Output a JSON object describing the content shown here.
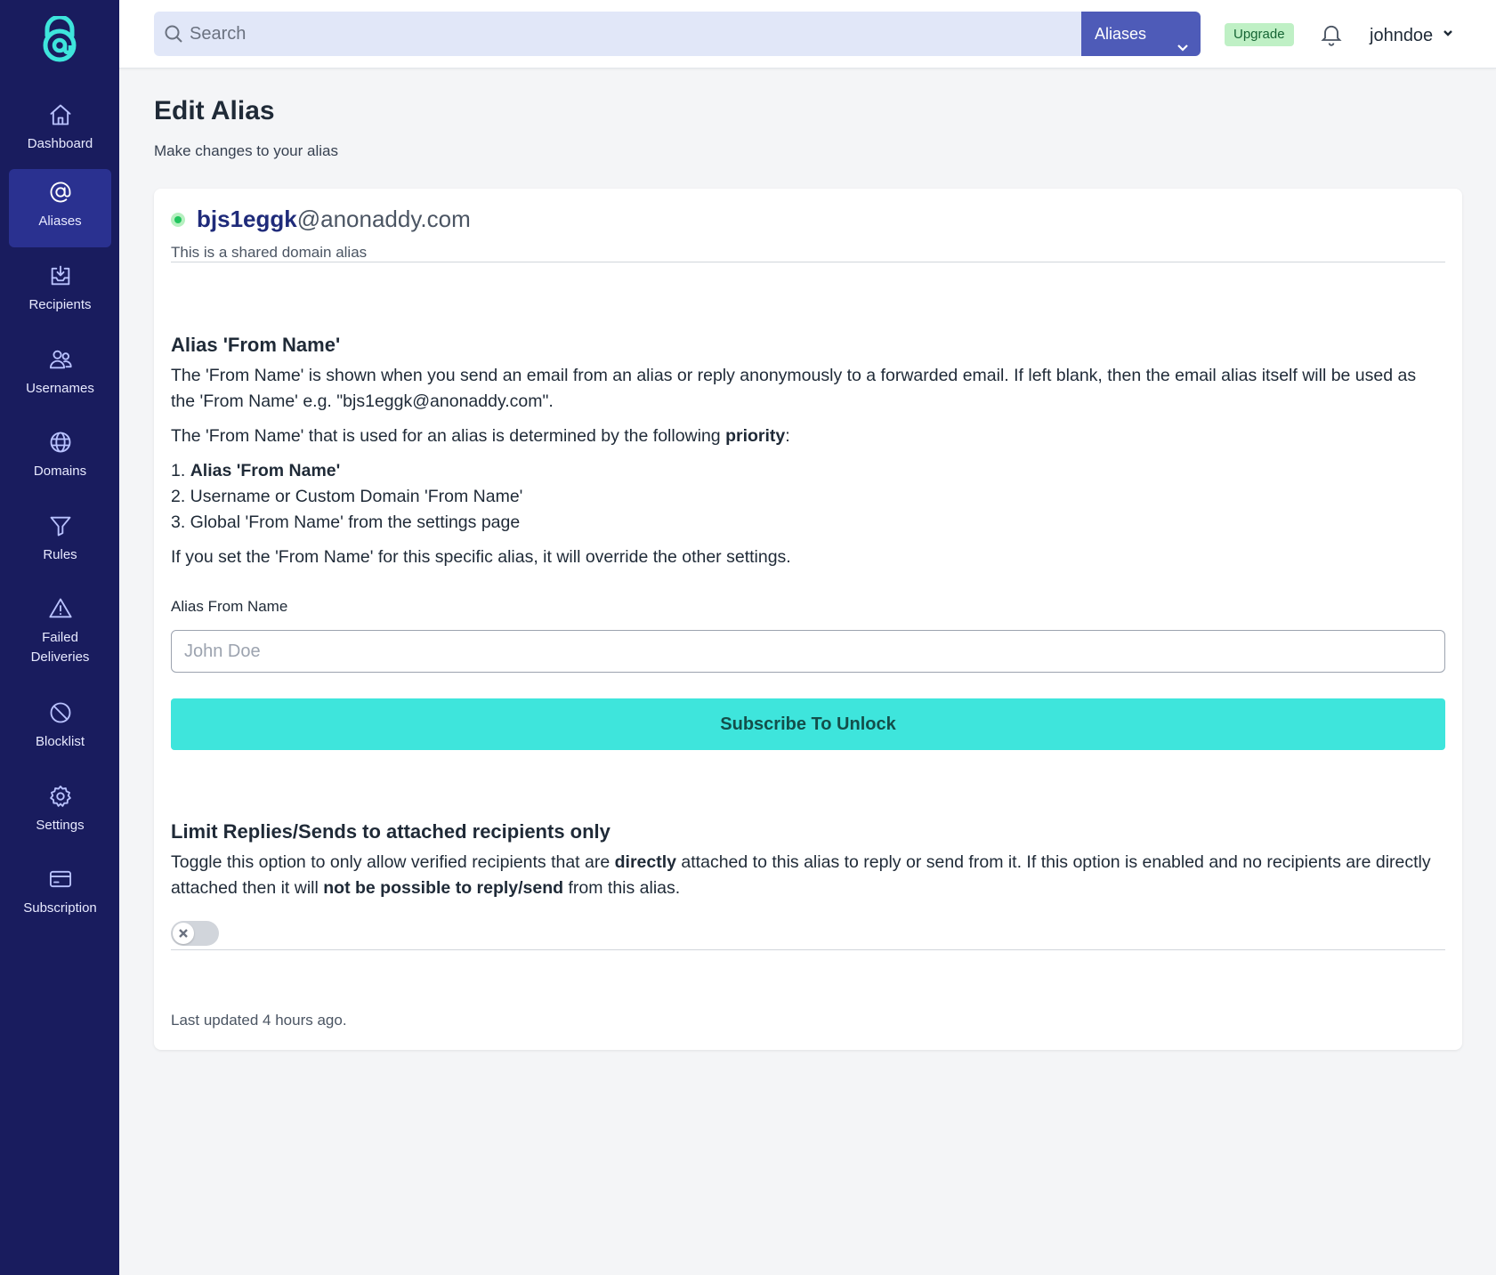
{
  "sidebar": {
    "items": [
      {
        "label": "Dashboard",
        "icon": "home-icon"
      },
      {
        "label": "Aliases",
        "icon": "at-icon"
      },
      {
        "label": "Recipients",
        "icon": "inbox-icon"
      },
      {
        "label": "Usernames",
        "icon": "users-icon"
      },
      {
        "label": "Domains",
        "icon": "globe-icon"
      },
      {
        "label": "Rules",
        "icon": "funnel-icon"
      },
      {
        "label": "Failed\nDeliveries",
        "icon": "warning-icon"
      },
      {
        "label": "Blocklist",
        "icon": "ban-icon"
      },
      {
        "label": "Settings",
        "icon": "gear-icon"
      },
      {
        "label": "Subscription",
        "icon": "credit-card-icon"
      }
    ],
    "active": "Aliases"
  },
  "topbar": {
    "search_placeholder": "Search",
    "search_scope": "Aliases",
    "upgrade_label": "Upgrade",
    "username": "johndoe"
  },
  "page": {
    "title": "Edit Alias",
    "subtitle": "Make changes to your alias"
  },
  "alias": {
    "local_part": "bjs1eggk",
    "domain_part": "@anonaddy.com",
    "description": "This is a shared domain alias",
    "active": true
  },
  "from_name_section": {
    "title": "Alias 'From Name'",
    "para1": "The 'From Name' is shown when you send an email from an alias or reply anonymously to a forwarded email. If left blank, then the email alias itself will be used as the 'From Name' e.g. \"bjs1eggk@anonaddy.com\".",
    "para2_prefix": "The 'From Name' that is used for an alias is determined by the following ",
    "para2_bold": "priority",
    "para2_suffix": ":",
    "priority_1_num": "1. ",
    "priority_1": "Alias 'From Name'",
    "priority_2": "2. Username or Custom Domain 'From Name'",
    "priority_3": "3. Global 'From Name' from the settings page",
    "para3": "If you set the 'From Name' for this specific alias, it will override the other settings.",
    "field_label": "Alias From Name",
    "field_placeholder": "John Doe",
    "field_value": "",
    "button_label": "Subscribe To Unlock"
  },
  "limit_section": {
    "title": "Limit Replies/Sends to attached recipients only",
    "text_1": "Toggle this option to only allow verified recipients that are ",
    "bold_1": "directly",
    "text_2": " attached to this alias to reply or send from it. If this option is enabled and no recipients are directly attached then it will ",
    "bold_2": "not be possible to reply/send",
    "text_3": " from this alias.",
    "toggle_enabled": false
  },
  "footer": {
    "last_updated": "Last updated 4 hours ago."
  },
  "colors": {
    "sidebar_bg": "#191c5e",
    "sidebar_active": "#2a3190",
    "accent_button": "#3ee5dc",
    "search_scope_bg": "#4e5bb8",
    "status_green": "#22c55e"
  }
}
